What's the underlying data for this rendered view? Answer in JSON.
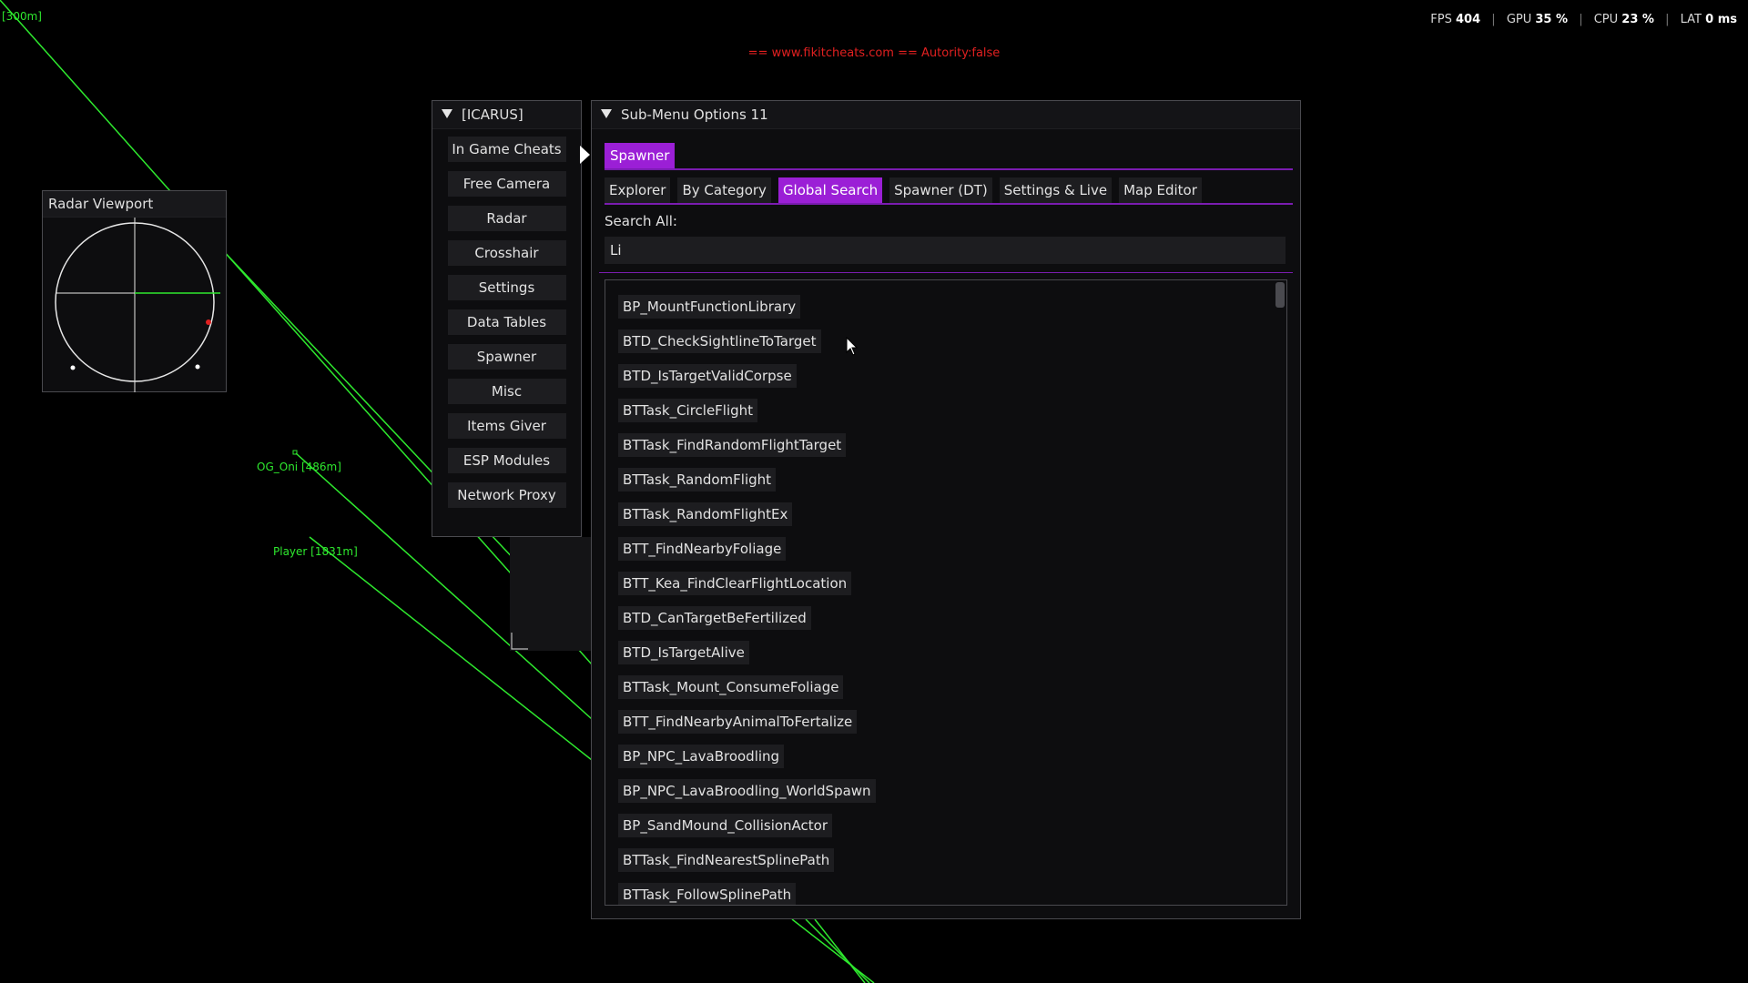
{
  "overlay": {
    "corner_label": "[300m]",
    "watermark": "== www.fikitcheats.com == Autority:false",
    "esp_labels": [
      {
        "name": "OG_Oni [486m]"
      },
      {
        "name": "Player [1831m]"
      }
    ]
  },
  "hud": {
    "fps_label": "FPS",
    "fps_value": "404",
    "gpu_label": "GPU",
    "gpu_value": "35 %",
    "cpu_label": "CPU",
    "cpu_value": "23 %",
    "lat_label": "LAT",
    "lat_value": "0 ms"
  },
  "radar": {
    "title": "Radar Viewport"
  },
  "main_menu": {
    "title": "[ICARUS]",
    "items": [
      "In Game Cheats",
      "Free Camera",
      "Radar",
      "Crosshair",
      "Settings",
      "Data Tables",
      "Spawner",
      "Misc",
      "Items Giver",
      "ESP Modules",
      "Network Proxy"
    ]
  },
  "submenu": {
    "title": "Sub-Menu Options 11",
    "primary_tab": "Spawner",
    "tabs": [
      {
        "label": "Explorer",
        "active": false
      },
      {
        "label": "By Category",
        "active": false
      },
      {
        "label": "Global Search",
        "active": true
      },
      {
        "label": "Spawner (DT)",
        "active": false
      },
      {
        "label": "Settings & Live",
        "active": false
      },
      {
        "label": "Map Editor",
        "active": false
      }
    ],
    "search_label": "Search All:",
    "search_value": "Li",
    "results": [
      "BP_MountFunctionLibrary",
      "BTD_CheckSightlineToTarget",
      "BTD_IsTargetValidCorpse",
      "BTTask_CircleFlight",
      "BTTask_FindRandomFlightTarget",
      "BTTask_RandomFlight",
      "BTTask_RandomFlightEx",
      "BTT_FindNearbyFoliage",
      "BTT_Kea_FindClearFlightLocation",
      "BTD_CanTargetBeFertilized",
      "BTD_IsTargetAlive",
      "BTTask_Mount_ConsumeFoliage",
      "BTT_FindNearbyAnimalToFertalize",
      "BP_NPC_LavaBroodling",
      "BP_NPC_LavaBroodling_WorldSpawn",
      "BP_SandMound_CollisionActor",
      "BTTask_FindNearestSplinePath",
      "BTTask_FollowSplinePath"
    ]
  },
  "colors": {
    "accent": "#9b1fd6",
    "esp_line": "#2ee82e",
    "watermark": "#e02020"
  }
}
